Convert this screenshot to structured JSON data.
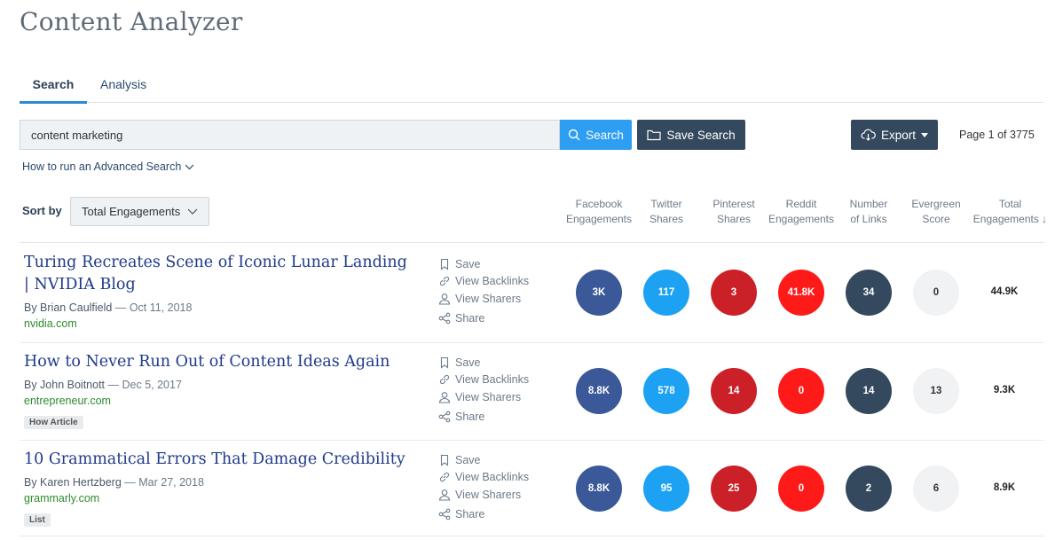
{
  "header": {
    "title": "Content Analyzer"
  },
  "tabs": [
    {
      "label": "Search"
    },
    {
      "label": "Analysis"
    }
  ],
  "search": {
    "value": "content marketing",
    "search_label": "Search",
    "save_label": "Save Search",
    "export_label": "Export",
    "page_info": "Page 1 of 3775",
    "advanced_link": "How to run an Advanced Search"
  },
  "sort": {
    "label": "Sort by",
    "value": "Total Engagements"
  },
  "columns": [
    {
      "line1": "Facebook",
      "line2": "Engagements"
    },
    {
      "line1": "Twitter",
      "line2": "Shares"
    },
    {
      "line1": "Pinterest",
      "line2": "Shares"
    },
    {
      "line1": "Reddit",
      "line2": "Engagements"
    },
    {
      "line1": "Number",
      "line2": "of Links"
    },
    {
      "line1": "Evergreen",
      "line2": "Score"
    },
    {
      "line1": "Total",
      "line2": "Engagements ↓"
    }
  ],
  "actions": {
    "save": "Save",
    "backlinks": "View Backlinks",
    "sharers": "View Sharers",
    "share": "Share"
  },
  "colors": {
    "facebook": "#3b5998",
    "twitter": "#1da1f2",
    "pinterest": "#cb2027",
    "reddit": "#ff1a1a",
    "links": "#34495e",
    "evergreen": "#f1f2f3",
    "accent": "#2d9ef2"
  },
  "results": [
    {
      "title": "Turing Recreates Scene of Iconic Lunar Landing | NVIDIA Blog",
      "author": "By Brian Caulfield",
      "date": "— Oct 11, 2018",
      "domain": "nvidia.com",
      "tag": "",
      "facebook": "3K",
      "twitter": "117",
      "pinterest": "3",
      "reddit": "41.8K",
      "links": "34",
      "evergreen": "0",
      "total": "44.9K"
    },
    {
      "title": "How to Never Run Out of Content Ideas Again",
      "author": "By John Boitnott",
      "date": "— Dec 5, 2017",
      "domain": "entrepreneur.com",
      "tag": "How Article",
      "facebook": "8.8K",
      "twitter": "578",
      "pinterest": "14",
      "reddit": "0",
      "links": "14",
      "evergreen": "13",
      "total": "9.3K"
    },
    {
      "title": "10 Grammatical Errors That Damage Credibility",
      "author": "By Karen Hertzberg",
      "date": "— Mar 27, 2018",
      "domain": "grammarly.com",
      "tag": "List",
      "facebook": "8.8K",
      "twitter": "95",
      "pinterest": "25",
      "reddit": "0",
      "links": "2",
      "evergreen": "6",
      "total": "8.9K"
    }
  ]
}
